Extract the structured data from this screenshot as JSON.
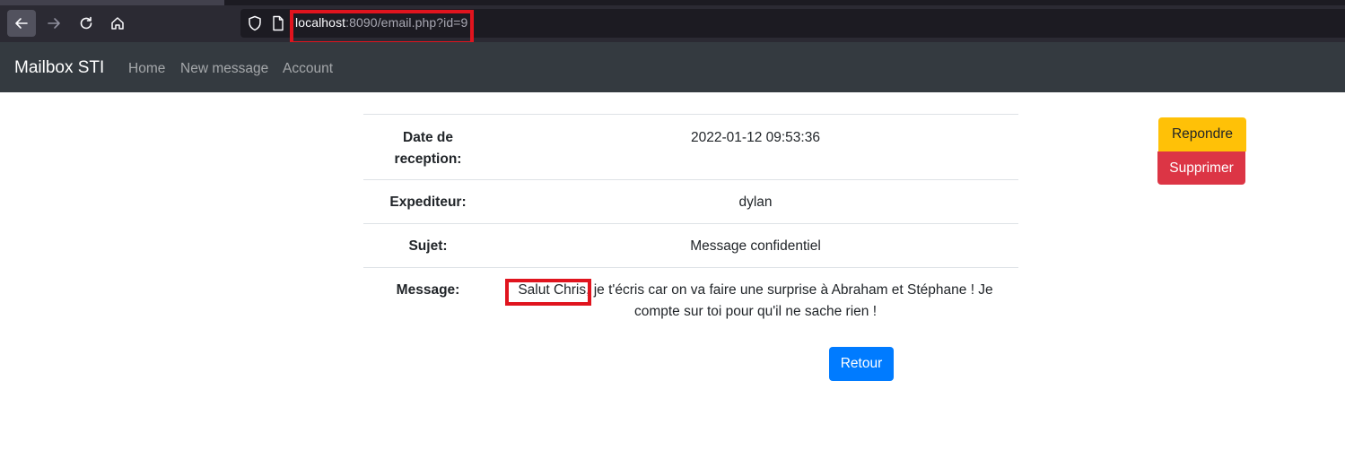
{
  "browser": {
    "url_host": "localhost",
    "url_rest": ":8090/email.php?id=9"
  },
  "navbar": {
    "brand": "Mailbox STI",
    "links": [
      "Home",
      "New message",
      "Account"
    ]
  },
  "email": {
    "rows": [
      {
        "label_line1": "Date de",
        "label_line2": "reception:",
        "value": "2022-01-12 09:53:36"
      },
      {
        "label": "Expediteur:",
        "value": "dylan"
      },
      {
        "label": "Sujet:",
        "value": "Message confidentiel"
      },
      {
        "label": "Message:",
        "value_line1": "Salut Chris, je t'écris car on va faire une surprise à Abraham et Stéphane ! Je",
        "value_line2": "compte sur toi pour qu'il ne sache rien !"
      }
    ],
    "back_button": "Retour"
  },
  "actions": {
    "reply": "Repondre",
    "delete": "Supprimer"
  },
  "colors": {
    "navbar": "#343a40",
    "primary": "#007bff",
    "warning": "#ffc107",
    "danger": "#dc3545",
    "annotation": "#e0141e"
  }
}
